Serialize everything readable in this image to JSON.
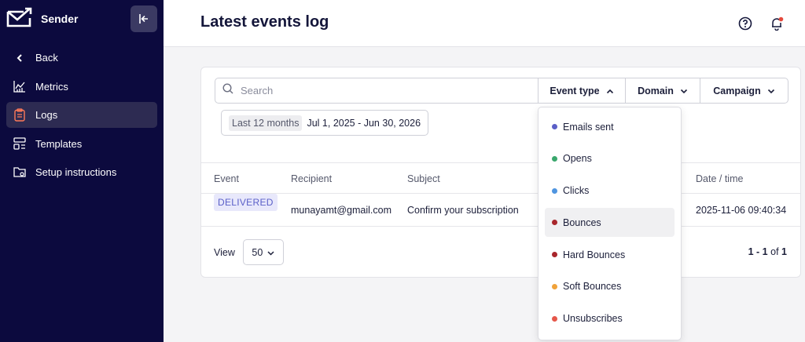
{
  "sidebar": {
    "brand": "Sender",
    "items": [
      {
        "label": "Back"
      },
      {
        "label": "Metrics"
      },
      {
        "label": "Logs"
      },
      {
        "label": "Templates"
      },
      {
        "label": "Setup instructions"
      }
    ],
    "active_item": "Logs"
  },
  "header": {
    "title": "Latest events log",
    "icons": [
      "help-icon",
      "bell-icon"
    ],
    "notification_dot_color": "#e5483b"
  },
  "filters": {
    "search_placeholder": "Search",
    "event_type_label": "Event type",
    "domain_label": "Domain",
    "campaign_label": "Campaign",
    "date_chip": "Last 12 months",
    "date_value": "Jul 1, 2025 - Jun 30, 2026"
  },
  "table": {
    "columns": [
      "Event",
      "Recipient",
      "Subject",
      "Date / time"
    ],
    "rows": [
      {
        "event": "DELIVERED",
        "recipient": "munayamt@gmail.com",
        "subject": "Confirm your subscription",
        "datetime": "2025-11-06 09:40:34"
      }
    ]
  },
  "footer": {
    "view_label": "View",
    "page_size": "50",
    "pager_range": "1 - 1",
    "pager_of": "of",
    "pager_total": "1"
  },
  "event_type_dropdown": {
    "items": [
      {
        "label": "Emails sent",
        "color": "#5b5fc7"
      },
      {
        "label": "Opens",
        "color": "#3aa76d"
      },
      {
        "label": "Clicks",
        "color": "#4f95e0"
      },
      {
        "label": "Bounces",
        "color": "#a8262c"
      },
      {
        "label": "Hard Bounces",
        "color": "#a8262c"
      },
      {
        "label": "Soft Bounces",
        "color": "#f0a23a"
      },
      {
        "label": "Unsubscribes",
        "color": "#e5574a"
      }
    ],
    "highlighted_item": "Bounces"
  },
  "colors": {
    "sidebar_bg": "#0c0a3e",
    "accent_active_icon": "#ff7a59",
    "badge_bg": "#e8e8fb",
    "badge_text": "#5a5fc8"
  }
}
